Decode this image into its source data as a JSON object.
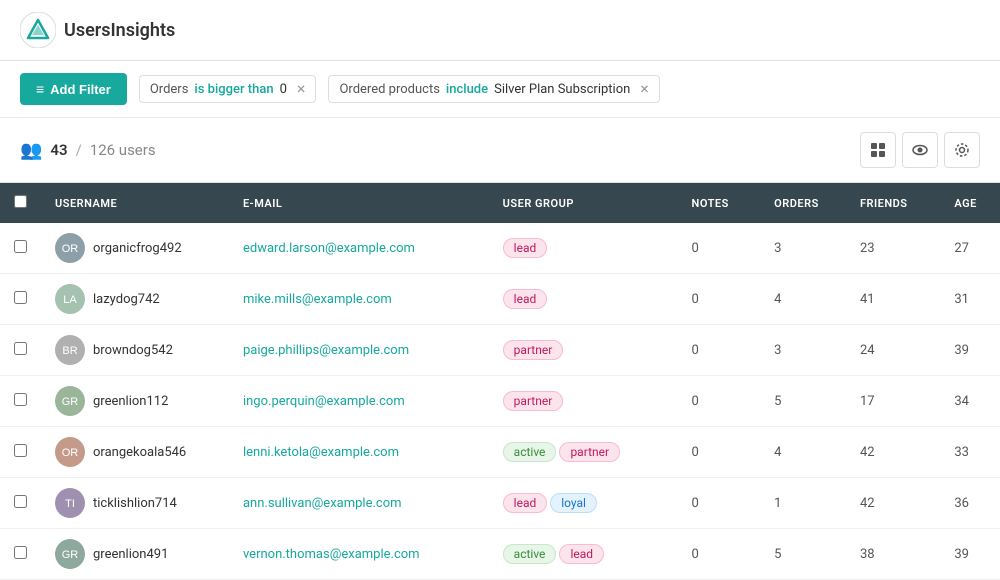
{
  "app": {
    "logo_text": "UsersInsights"
  },
  "filter_bar": {
    "add_filter_label": "Add Filter",
    "chips": [
      {
        "key": "Orders",
        "op": "is bigger than",
        "val": "0"
      },
      {
        "key": "Ordered products",
        "op": "include",
        "val": "Silver Plan Subscription"
      }
    ]
  },
  "count_bar": {
    "current": "43",
    "total": "126",
    "label": "users"
  },
  "table": {
    "columns": [
      "USERNAME",
      "E-MAIL",
      "USER GROUP",
      "NOTES",
      "ORDERS",
      "FRIENDS",
      "AGE"
    ],
    "rows": [
      {
        "username": "organicfrog492",
        "email": "edward.larson@example.com",
        "groups": [
          {
            "label": "lead",
            "type": "lead"
          }
        ],
        "notes": "0",
        "orders": "3",
        "friends": "23",
        "age": "27",
        "avatar_color": "#8d9fa8"
      },
      {
        "username": "lazydog742",
        "email": "mike.mills@example.com",
        "groups": [
          {
            "label": "lead",
            "type": "lead"
          }
        ],
        "notes": "0",
        "orders": "4",
        "friends": "41",
        "age": "31",
        "avatar_color": "#a5c1b0"
      },
      {
        "username": "browndog542",
        "email": "paige.phillips@example.com",
        "groups": [
          {
            "label": "partner",
            "type": "partner"
          }
        ],
        "notes": "0",
        "orders": "3",
        "friends": "24",
        "age": "39",
        "avatar_color": "#b0b0b0"
      },
      {
        "username": "greenlion112",
        "email": "ingo.perquin@example.com",
        "groups": [
          {
            "label": "partner",
            "type": "partner"
          }
        ],
        "notes": "0",
        "orders": "5",
        "friends": "17",
        "age": "34",
        "avatar_color": "#9ab59a"
      },
      {
        "username": "orangekoala546",
        "email": "lenni.ketola@example.com",
        "groups": [
          {
            "label": "active",
            "type": "active"
          },
          {
            "label": "partner",
            "type": "partner"
          }
        ],
        "notes": "0",
        "orders": "4",
        "friends": "42",
        "age": "33",
        "avatar_color": "#c49a8a"
      },
      {
        "username": "ticklishlion714",
        "email": "ann.sullivan@example.com",
        "groups": [
          {
            "label": "lead",
            "type": "lead"
          },
          {
            "label": "loyal",
            "type": "loyal"
          }
        ],
        "notes": "0",
        "orders": "1",
        "friends": "42",
        "age": "36",
        "avatar_color": "#a090b0"
      },
      {
        "username": "greenlion491",
        "email": "vernon.thomas@example.com",
        "groups": [
          {
            "label": "active",
            "type": "active"
          },
          {
            "label": "lead",
            "type": "lead"
          }
        ],
        "notes": "0",
        "orders": "5",
        "friends": "38",
        "age": "39",
        "avatar_color": "#8fa89e"
      }
    ]
  },
  "icons": {
    "filter": "≡",
    "users": "👥",
    "grid_view": "⊞",
    "eye_view": "◉",
    "settings": "⚙"
  }
}
